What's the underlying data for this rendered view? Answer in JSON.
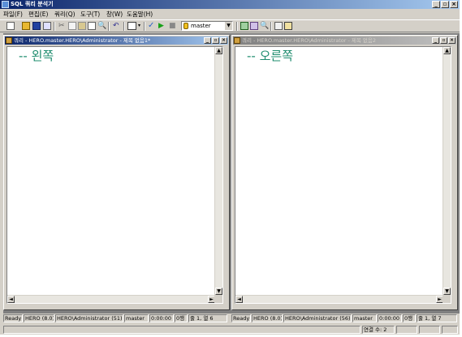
{
  "app": {
    "title": "SQL 쿼리 분석기",
    "caption_min": "_",
    "caption_max": "▫",
    "caption_close": "×"
  },
  "menu": [
    "파일(F)",
    "편집(E)",
    "쿼리(Q)",
    "도구(T)",
    "창(W)",
    "도움말(H)"
  ],
  "toolbar": {
    "database": "master",
    "icons": [
      "new-query-icon",
      "open-icon",
      "save-icon",
      "insert-template-icon",
      "cut-icon",
      "copy-icon",
      "paste-icon",
      "clear-icon",
      "find-icon",
      "undo-icon",
      "results-mode-icon",
      "parse-icon",
      "execute-icon",
      "stop-icon",
      "object-browser-icon",
      "object-search-icon",
      "show-plan-icon",
      "properties-icon",
      "results-pane-icon"
    ]
  },
  "windows": {
    "left": {
      "title": "쿼리 - HERO.master.HERO\\Administrator - 제목 없음1*",
      "code": "-- 왼쪽",
      "status": {
        "ready": "Ready",
        "server": "HERO (8.0)",
        "user": "HERO\\Administrator (51)",
        "db": "master",
        "time": "0:00:00",
        "rows": "0행",
        "pos": "줄 1, 열 6"
      }
    },
    "right": {
      "title": "쿼리 - HERO.master.HERO\\Administrator - 제목 없음2",
      "code": "-- 오른쪽",
      "status": {
        "ready": "Ready",
        "server": "HERO (8.0)",
        "user": "HERO\\Administrator (56)",
        "db": "master",
        "time": "0:00:00",
        "rows": "0행",
        "pos": "줄 1, 열 7"
      }
    }
  },
  "appstatus": {
    "connections": "연결 수: 2"
  },
  "colors": {
    "active_title": "#0a246a",
    "inactive_title": "#808080",
    "code_text": "#1e8c6e",
    "face": "#d4d0c8"
  }
}
